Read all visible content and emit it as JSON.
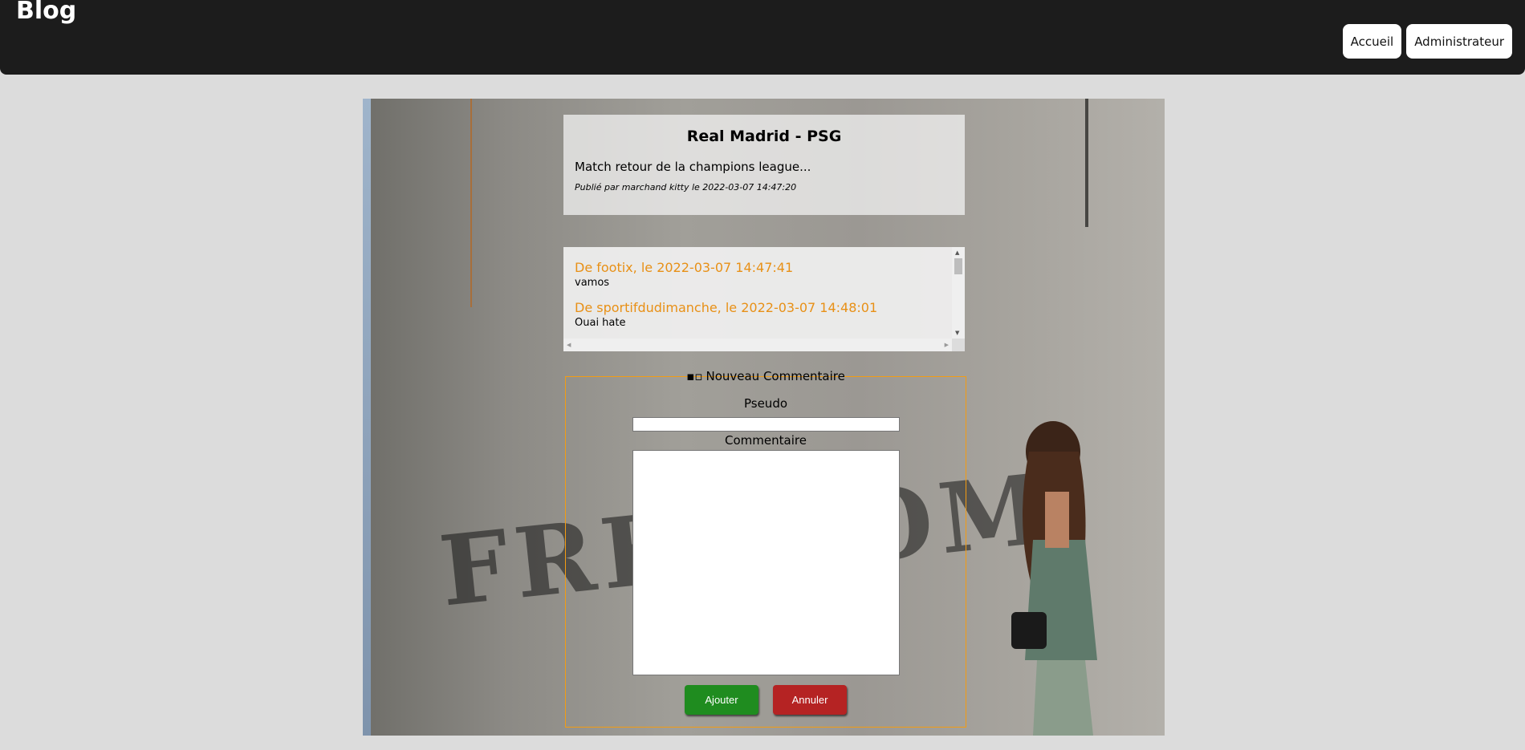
{
  "header": {
    "brand": "Blog",
    "nav": [
      {
        "label": "Accueil"
      },
      {
        "label": "Administrateur"
      }
    ]
  },
  "post": {
    "title": "Real Madrid - PSG",
    "body": "Match retour de la champions league...",
    "meta": "Publié par marchand kitty le 2022-03-07 14:47:20"
  },
  "comments": [
    {
      "header": "De footix, le 2022-03-07 14:47:41",
      "text": "vamos"
    },
    {
      "header": "De sportifdudimanche, le 2022-03-07 14:48:01",
      "text": "Ouai hate"
    }
  ],
  "form": {
    "legend": "Nouveau Commentaire",
    "legend_icon": "comment-icon",
    "pseudo_label": "Pseudo",
    "pseudo_value": "",
    "comment_label": "Commentaire",
    "comment_value": "",
    "add_label": "Ajouter",
    "cancel_label": "Annuler"
  },
  "colors": {
    "header_bg": "#1c1c1c",
    "page_bg": "#dcdcdc",
    "comment_author": "#e89016",
    "form_border": "#f39c12",
    "add_button": "#1f8c1f",
    "cancel_button": "#b52323"
  }
}
